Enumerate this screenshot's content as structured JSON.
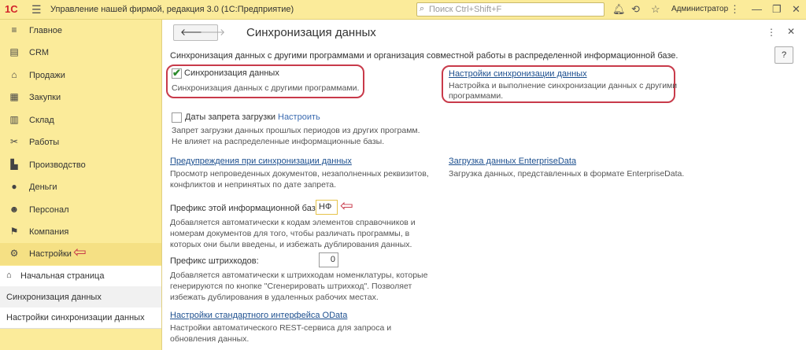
{
  "titlebar": {
    "app_title": "Управление нашей фирмой, редакция 3.0 (1С:Предприятие)",
    "logo": "1С",
    "search_placeholder": "Поиск Ctrl+Shift+F",
    "user": "Администратор"
  },
  "sidebar": {
    "items": [
      {
        "label": "Главное",
        "icon": "menu-lines-icon"
      },
      {
        "label": "CRM",
        "icon": "crm-icon"
      },
      {
        "label": "Продажи",
        "icon": "basket-icon"
      },
      {
        "label": "Закупки",
        "icon": "purchase-icon"
      },
      {
        "label": "Склад",
        "icon": "warehouse-icon"
      },
      {
        "label": "Работы",
        "icon": "tools-icon"
      },
      {
        "label": "Производство",
        "icon": "factory-icon"
      },
      {
        "label": "Деньги",
        "icon": "money-icon"
      },
      {
        "label": "Персонал",
        "icon": "person-icon"
      },
      {
        "label": "Компания",
        "icon": "flag-icon"
      },
      {
        "label": "Настройки",
        "icon": "gear-icon"
      }
    ],
    "home": "Начальная страница",
    "open_windows": [
      "Синхронизация данных",
      "Настройки синхронизации данных"
    ]
  },
  "main": {
    "title": "Синхронизация данных",
    "help": "?",
    "intro": "Синхронизация данных с другими программами и организация совместной работы в распределенной информационной базе.",
    "sync_checkbox": {
      "label": "Синхронизация данных",
      "desc": "Синхронизация данных с другими программами.",
      "checked": true
    },
    "sync_settings": {
      "label": "Настройки синхронизации данных",
      "desc1": "Настройка и выполнение синхронизации данных с другими",
      "desc2": "программами."
    },
    "ban_checkbox": {
      "label": "Даты запрета загрузки",
      "link": "Настроить",
      "desc1": "Запрет загрузки данных прошлых периодов из других программ.",
      "desc2": "Не влияет на распределенные информационные базы."
    },
    "warnings": {
      "label": "Предупреждения при синхронизации данных",
      "desc1": "Просмотр непроведенных документов, незаполненных реквизитов,",
      "desc2": "конфликтов и непринятых по дате запрета."
    },
    "enterprise": {
      "label": "Загрузка данных EnterpriseData",
      "desc": "Загрузка данных, представленных в формате EnterpriseData."
    },
    "prefix": {
      "label": "Префикс этой информационной базы:",
      "value": "НФ",
      "desc1": "Добавляется автоматически к кодам элементов справочников и",
      "desc2": "номерам документов для того, чтобы различать программы, в",
      "desc3": "которых они были введены, и избежать дублирования данных."
    },
    "barcode": {
      "label": "Префикс штрихкодов:",
      "value": "0",
      "desc1": "Добавляется автоматически к штрихкодам номенклатуры, которые",
      "desc2": "генерируются по кнопке \"Сгенерировать штрихкод\". Позволяет",
      "desc3": "избежать дублирования в удаленных рабочих местах."
    },
    "odata": {
      "label": "Настройки стандартного интерфейса OData",
      "desc1": "Настройки автоматического REST-сервиса для запроса и",
      "desc2": "обновления данных."
    }
  },
  "colors": {
    "highlight": "#c83a4a",
    "sidebar_bg": "#fbeb9a",
    "link": "#1c4f8f"
  }
}
